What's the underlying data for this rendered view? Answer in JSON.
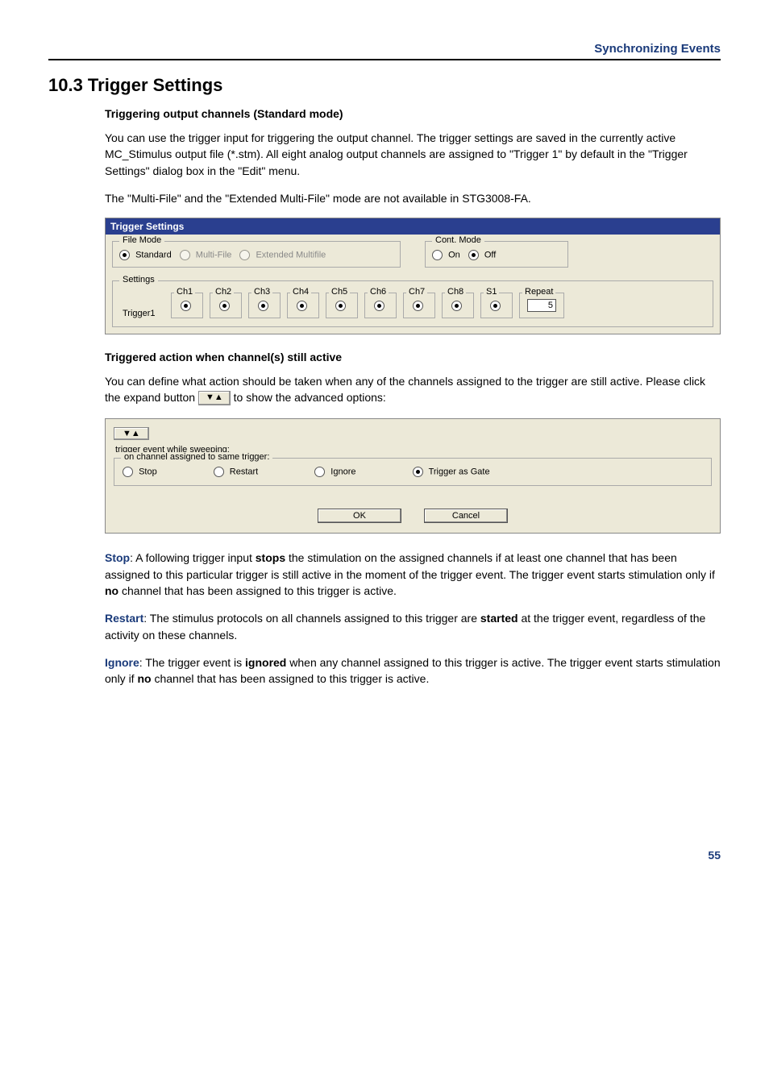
{
  "header": {
    "chapter_title": "Synchronizing Events"
  },
  "section": {
    "number_title": "10.3 Trigger Settings",
    "sub1": "Triggering output channels (Standard mode)",
    "p1": "You can use the trigger input for triggering the output channel. The trigger settings are saved in the currently active MC_Stimulus output file (*.stm). All eight analog output channels are assigned to \"Trigger 1\" by default in the \"Trigger Settings\" dialog box in the \"Edit\" menu.",
    "p2": "The \"Multi-File\" and the \"Extended Multi-File\" mode are not available in STG3008-FA.",
    "sub2": "Triggered action when channel(s) still active",
    "p3a": "You can define what action should be taken when any of the channels assigned to the trigger are still active. Please click the expand button ",
    "p3b": " to show the advanced options:",
    "expand_glyph_inline": "▼▲"
  },
  "dlg1": {
    "title": "Trigger Settings",
    "file_mode": {
      "legend": "File Mode",
      "opts": [
        {
          "label": "Standard",
          "selected": true,
          "disabled": false
        },
        {
          "label": "Multi-File",
          "selected": false,
          "disabled": true
        },
        {
          "label": "Extended Multifile",
          "selected": false,
          "disabled": true
        }
      ]
    },
    "cont_mode": {
      "legend": "Cont. Mode",
      "opts": [
        {
          "label": "On",
          "selected": false
        },
        {
          "label": "Off",
          "selected": true
        }
      ]
    },
    "settings": {
      "legend": "Settings",
      "row_label": "Trigger1",
      "channels": [
        "Ch1",
        "Ch2",
        "Ch3",
        "Ch4",
        "Ch5",
        "Ch6",
        "Ch7",
        "Ch8",
        "S1"
      ],
      "repeat_label": "Repeat",
      "repeat_value": "5"
    }
  },
  "dlg2": {
    "expand_glyph": "▼▲",
    "sweep_label": "trigger event while sweeping:",
    "group_legend": "on channel assigned to same trigger:",
    "opts": [
      {
        "label": "Stop",
        "selected": false
      },
      {
        "label": "Restart",
        "selected": false
      },
      {
        "label": "Ignore",
        "selected": false
      },
      {
        "label": "Trigger as Gate",
        "selected": true
      }
    ],
    "ok": "OK",
    "cancel": "Cancel"
  },
  "defs": {
    "stop_head": "Stop",
    "stop_body_a": ": A following trigger input ",
    "stop_bold": "stops",
    "stop_body_b": " the stimulation on the assigned channels if at least one channel that has been assigned to this particular trigger is still active in the moment of the trigger event. The trigger event starts stimulation only if ",
    "stop_bold2": "no",
    "stop_body_c": " channel that has been assigned to this trigger is active.",
    "restart_head": "Restart",
    "restart_body_a": ": The stimulus protocols on all channels assigned to this trigger are ",
    "restart_bold": "started",
    "restart_body_b": " at the trigger event, regardless of the activity on these channels.",
    "ignore_head": "Ignore",
    "ignore_body_a": ": The trigger event is ",
    "ignore_bold": "ignored",
    "ignore_body_b": " when any channel assigned to this trigger is active. The trigger event starts stimulation only if ",
    "ignore_bold2": "no",
    "ignore_body_c": " channel that has been assigned to this trigger is active."
  },
  "page_number": "55"
}
